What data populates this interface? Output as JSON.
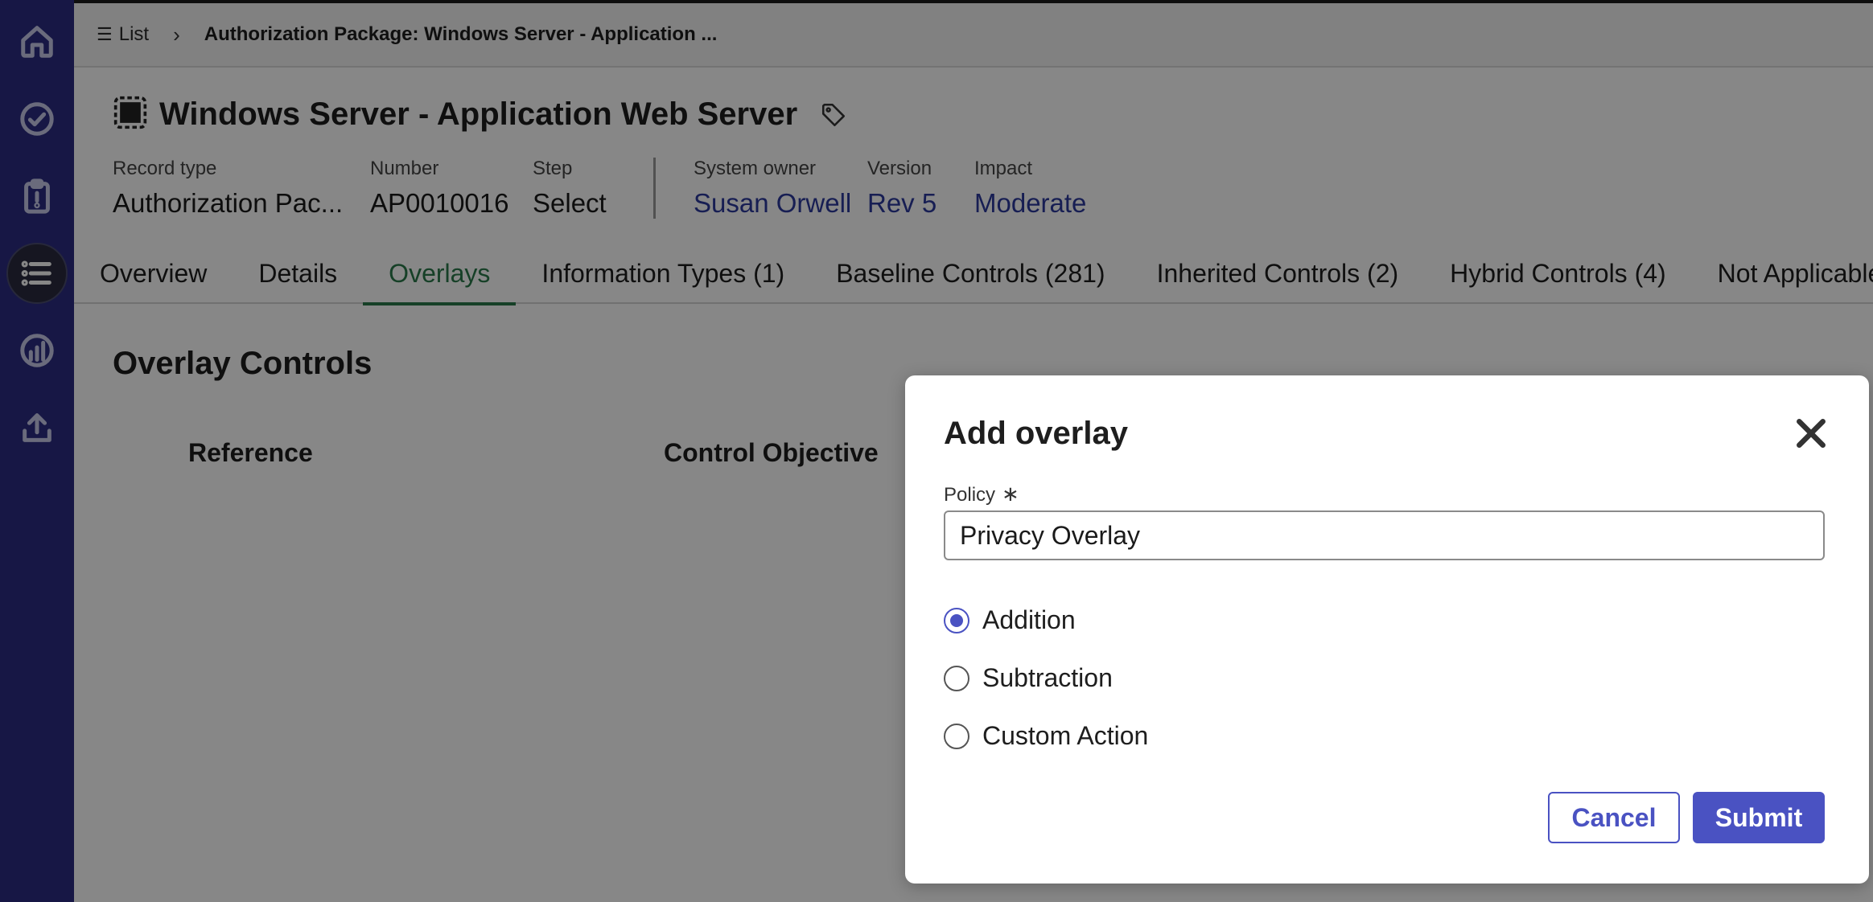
{
  "breadcrumb": {
    "list_label": "List",
    "current": "Authorization Package: Windows Server - Application ..."
  },
  "sidebar": {
    "items": [
      {
        "icon": "home-icon"
      },
      {
        "icon": "check-circle-icon"
      },
      {
        "icon": "clipboard-icon"
      },
      {
        "icon": "list-icon",
        "active": true
      },
      {
        "icon": "analytics-icon"
      },
      {
        "icon": "upload-icon"
      }
    ]
  },
  "header": {
    "title": "Windows Server - Application Web Server",
    "fields": [
      {
        "label": "Record type",
        "value": "Authorization Pac..."
      },
      {
        "label": "Number",
        "value": "AP0010016"
      },
      {
        "label": "Step",
        "value": "Select"
      },
      {
        "label": "System owner",
        "value": "Susan Orwell"
      },
      {
        "label": "Version",
        "value": "Rev 5"
      },
      {
        "label": "Impact",
        "value": "Moderate"
      }
    ]
  },
  "tabs": [
    {
      "label": "Overview"
    },
    {
      "label": "Details"
    },
    {
      "label": "Overlays",
      "active": true
    },
    {
      "label": "Information Types (1)"
    },
    {
      "label": "Baseline Controls (281)"
    },
    {
      "label": "Inherited Controls (2)"
    },
    {
      "label": "Hybrid Controls (4)"
    },
    {
      "label": "Not Applicable"
    }
  ],
  "content": {
    "section_title": "Overlay Controls",
    "columns": [
      "Reference",
      "Control Objective"
    ]
  },
  "modal": {
    "title": "Add overlay",
    "policy_label": "Policy",
    "required_mark": "∗",
    "policy_value": "Privacy Overlay",
    "options": [
      {
        "label": "Addition",
        "checked": true
      },
      {
        "label": "Subtraction",
        "checked": false
      },
      {
        "label": "Custom Action",
        "checked": false
      }
    ],
    "cancel_label": "Cancel",
    "submit_label": "Submit"
  },
  "colors": {
    "sidebar": "#2c2d82",
    "accent": "#4a52c2",
    "link": "#2d3a9e",
    "active_tab": "#2a7a4a"
  }
}
